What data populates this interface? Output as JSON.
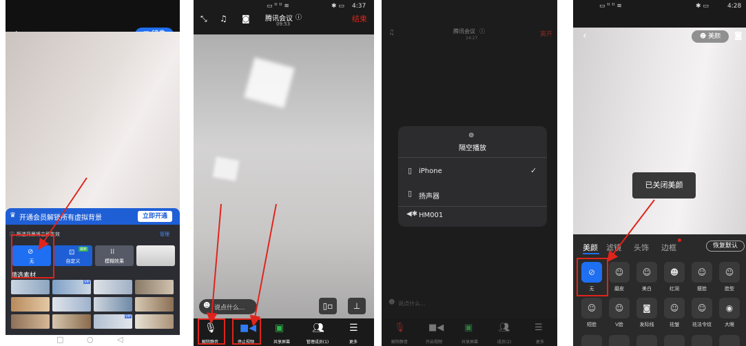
{
  "panel1": {
    "mirror_label": "镜像",
    "promo_text": "开通会员解锁所有虚拟背景",
    "promo_button": "立即开通",
    "notice_text": "所选背景将立即生效",
    "manage": "管理",
    "options": [
      "无",
      "自定义",
      "模糊效果"
    ],
    "section": "精选素材",
    "vip_badge": "VIP",
    "new_badge": "最新"
  },
  "panel2": {
    "status_time": "4:37",
    "meeting_title": "腾讯会议",
    "meeting_time": "09:53",
    "end_button": "结束",
    "chat_placeholder": "说点什么...",
    "controls": [
      "解除静音",
      "停止视频",
      "共享屏幕",
      "管理成员(1)",
      "更多"
    ]
  },
  "panel3": {
    "meeting_title": "腾讯会议",
    "meeting_time": "24:27",
    "leave_button": "离开",
    "airplay_title": "隔空播放",
    "devices": [
      "iPhone",
      "扬声器",
      "HM001"
    ],
    "chat_placeholder": "说点什么...",
    "controls": [
      "解除静音",
      "开启视频",
      "共享屏幕",
      "成员(2)",
      "更多"
    ]
  },
  "panel4": {
    "status_time": "4:28",
    "beauty_button": "美颜",
    "toast": "已关闭美颜",
    "tabs": [
      "美颜",
      "滤镜",
      "头饰",
      "边框"
    ],
    "reset_button": "恢复默认",
    "row1": [
      "无",
      "磨皮",
      "美白",
      "红润",
      "瘦脸",
      "脸型"
    ],
    "row2": [
      "短脸",
      "V脸",
      "发际线",
      "祛皱",
      "祛法令纹",
      "大眼"
    ]
  },
  "colors": {
    "accent_blue": "#1f6ff2",
    "warning_red": "#e0241b",
    "dark_bar": "#1a1a1a"
  }
}
